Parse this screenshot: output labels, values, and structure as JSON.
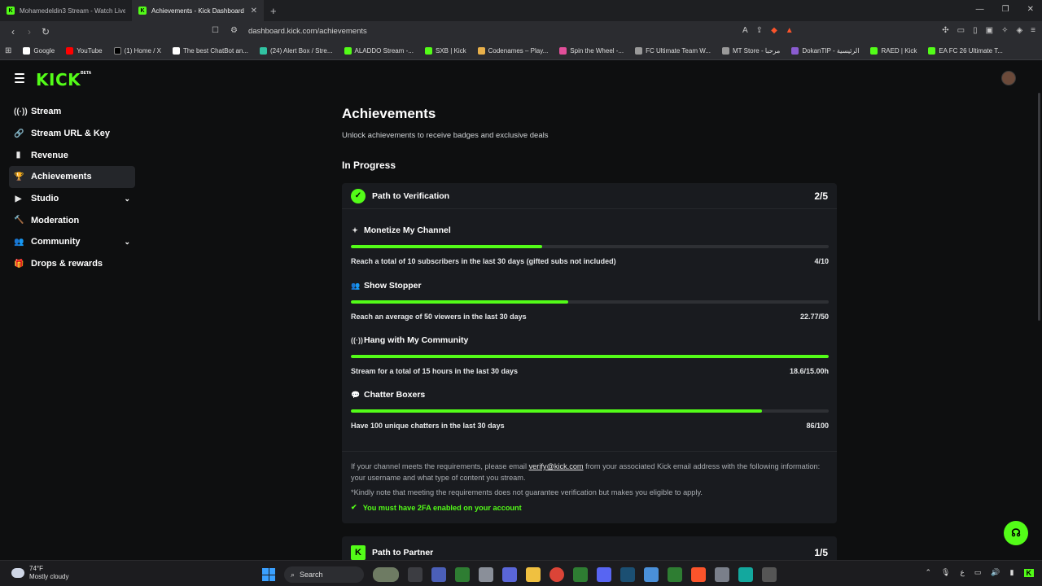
{
  "browser": {
    "tabs": [
      {
        "title": "Mohamedeldin3 Stream - Watch Live",
        "active": false
      },
      {
        "title": "Achievements - Kick Dashboard",
        "active": true
      }
    ],
    "new_tab": "+",
    "url": "dashboard.kick.com/achievements",
    "bookmarks": [
      "Google",
      "YouTube",
      "(1) Home / X",
      "The best ChatBot an...",
      "(24) Alert Box / Stre...",
      "ALADDO Stream -...",
      "SXB | Kick",
      "Codenames – Play...",
      "Spin the Wheel -...",
      "FC Ultimate Team W...",
      "MT Store - مرحبا",
      "DokanTIP - الرئيسية",
      "RAED | Kick",
      "EA FC 26 Ultimate T..."
    ]
  },
  "kick": {
    "logo": "KICK",
    "beta": "BETA",
    "sidebar": [
      {
        "label": "Stream",
        "icon": "broadcast-icon",
        "glyph": "((·))",
        "active": false,
        "chevron": false
      },
      {
        "label": "Stream URL & Key",
        "icon": "link-icon",
        "glyph": "🔗",
        "active": false,
        "chevron": false
      },
      {
        "label": "Revenue",
        "icon": "chart-icon",
        "glyph": "▮",
        "active": false,
        "chevron": false
      },
      {
        "label": "Achievements",
        "icon": "trophy-icon",
        "glyph": "🏆",
        "active": true,
        "chevron": false
      },
      {
        "label": "Studio",
        "icon": "studio-icon",
        "glyph": "▶",
        "active": false,
        "chevron": true
      },
      {
        "label": "Moderation",
        "icon": "hammer-icon",
        "glyph": "🔨",
        "active": false,
        "chevron": false
      },
      {
        "label": "Community",
        "icon": "people-icon",
        "glyph": "👥",
        "active": false,
        "chevron": true
      },
      {
        "label": "Drops & rewards",
        "icon": "gift-icon",
        "glyph": "🎁",
        "active": false,
        "chevron": false
      }
    ],
    "main": {
      "title": "Achievements",
      "subtitle": "Unlock achievements to receive badges and exclusive deals",
      "section": "In Progress",
      "verification": {
        "title": "Path to Verification",
        "count": "2/5",
        "achievements": [
          {
            "title": "Monetize My Channel",
            "icon": "sparkle-icon",
            "glyph": "✦",
            "desc": "Reach a total of 10 subscribers in the last 30 days (gifted subs not included)",
            "value": "4/10",
            "progress": 0.4
          },
          {
            "title": "Show Stopper",
            "icon": "users-icon",
            "glyph": "👥",
            "desc": "Reach an average of 50 viewers in the last 30 days",
            "value": "22.77/50",
            "progress": 0.455
          },
          {
            "title": "Hang with My Community",
            "icon": "signal-icon",
            "glyph": "((·))",
            "desc": "Stream for a total of 15 hours in the last 30 days",
            "value": "18.6/15.00h",
            "progress": 1.0
          },
          {
            "title": "Chatter Boxers",
            "icon": "chat-icon",
            "glyph": "💬",
            "desc": "Have 100 unique chatters in the last 30 days",
            "value": "86/100",
            "progress": 0.86
          }
        ],
        "note_prefix": "If your channel meets the requirements, please email ",
        "note_email": "verify@kick.com",
        "note_suffix": " from your associated Kick email address with the following information: your username and what type of content you stream.",
        "note2": "*Kindly note that meeting the requirements does not guarantee verification but makes you eligible to apply.",
        "requirement": "You must have 2FA enabled on your account"
      },
      "partner": {
        "title": "Path to Partner",
        "count": "1/5"
      }
    }
  },
  "taskbar": {
    "temp": "74°F",
    "weather": "Mostly cloudy",
    "search": "Search"
  },
  "colors": {
    "accent": "#53fc18",
    "bg": "#0e0f10",
    "card": "#191b1f"
  }
}
